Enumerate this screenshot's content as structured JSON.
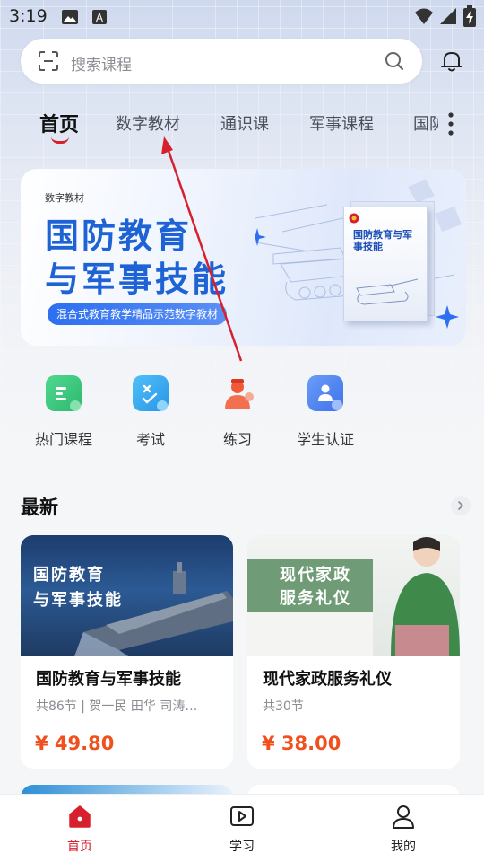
{
  "status_bar": {
    "time": "3:19",
    "left_icons": [
      "image-icon",
      "a-badge-icon"
    ],
    "right_icons": [
      "wifi-icon",
      "signal-icon",
      "battery-charging-icon"
    ]
  },
  "search": {
    "placeholder": "搜索课程"
  },
  "tabs": [
    {
      "label": "首页",
      "active": true
    },
    {
      "label": "数字教材",
      "active": false
    },
    {
      "label": "通识课",
      "active": false
    },
    {
      "label": "军事课程",
      "active": false
    },
    {
      "label": "国防",
      "active": false
    }
  ],
  "banner": {
    "small_label": "数字教材",
    "title_line1": "国防教育",
    "title_line2": "与军事技能",
    "pill_text": "混合式教育教学精品示范数字教材",
    "book_title": "国防教育与军事技能"
  },
  "quick_menu": [
    {
      "label": "热门课程",
      "icon": "document-icon",
      "color": "#3fc87e"
    },
    {
      "label": "考试",
      "icon": "exam-icon",
      "color": "#34a8f0"
    },
    {
      "label": "练习",
      "icon": "person-icon",
      "color": "#f05a3a"
    },
    {
      "label": "学生认证",
      "icon": "id-card-icon",
      "color": "#4a7ff0"
    }
  ],
  "section": {
    "title": "最新"
  },
  "courses": [
    {
      "image_title_line1": "国防教育",
      "image_title_line2": "与军事技能",
      "title": "国防教育与军事技能",
      "meta": "共86节 | 贺一民 田华 司涛…",
      "price": "¥ 49.80"
    },
    {
      "image_title_line1": "现代家政",
      "image_title_line2": "服务礼仪",
      "title": "现代家政服务礼仪",
      "meta": "共30节",
      "price": "¥ 38.00"
    }
  ],
  "bottom_nav": [
    {
      "label": "首页",
      "icon": "home-icon",
      "active": true
    },
    {
      "label": "学习",
      "icon": "play-icon",
      "active": false
    },
    {
      "label": "我的",
      "icon": "profile-icon",
      "active": false
    }
  ],
  "colors": {
    "accent_red": "#d6202d",
    "price_orange": "#f0501e",
    "banner_blue": "#1d63d6"
  }
}
